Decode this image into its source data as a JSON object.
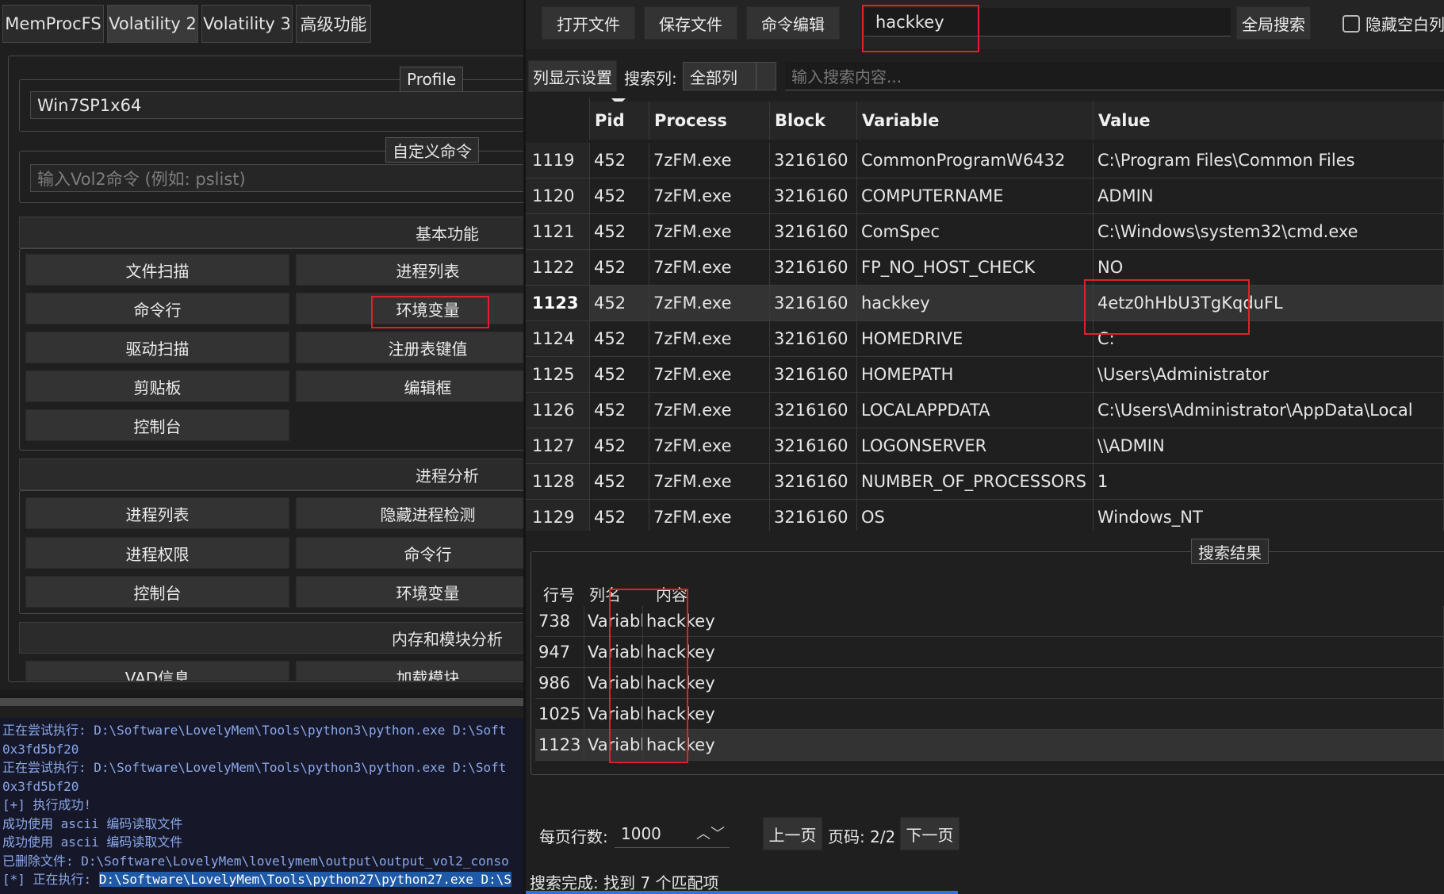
{
  "left": {
    "tabs": [
      "MemProcFS",
      "Volatility 2",
      "Volatility 3",
      "高级功能"
    ],
    "profile": {
      "legend": "Profile",
      "value": "Win7SP1x64"
    },
    "custom": {
      "legend": "自定义命令",
      "placeholder": "输入Vol2命令 (例如: pslist)"
    },
    "basic": {
      "title": "基本功能",
      "buttons": [
        "文件扫描",
        "进程列表",
        "命令行",
        "环境变量",
        "驱动扫描",
        "注册表键值",
        "剪贴板",
        "编辑框",
        "控制台"
      ]
    },
    "process": {
      "title": "进程分析",
      "buttons": [
        "进程列表",
        "隐藏进程检测",
        "进程权限",
        "命令行",
        "控制台",
        "环境变量"
      ]
    },
    "memory": {
      "title": "内存和模块分析",
      "buttons": [
        "VAD信息",
        "加载模块"
      ]
    }
  },
  "log": [
    "正在尝试执行: D:\\Software\\LovelyMem\\Tools\\python3\\python.exe D:\\Soft",
    "0x3fd5bf20",
    "正在尝试执行: D:\\Software\\LovelyMem\\Tools\\python3\\python.exe D:\\Soft",
    "0x3fd5bf20",
    "[+] 执行成功!",
    "成功使用 ascii 编码读取文件",
    "成功使用 ascii 编码读取文件",
    "已删除文件: D:\\Software\\LovelyMem\\lovelymem\\output\\output_vol2_conso"
  ],
  "log_last": {
    "prefix": "[*] 正在执行:",
    "highlight": "D:\\Software\\LovelyMem\\Tools\\python27\\python27.exe D:\\S"
  },
  "right": {
    "toolbar": {
      "open": "打开文件",
      "save": "保存文件",
      "edit": "命令编辑",
      "search_value": "hackkey",
      "global_search": "全局搜索",
      "hide_empty": "隐藏空白列"
    },
    "filter": {
      "col_settings": "列显示设置",
      "search_col_label": "搜索列:",
      "search_col_value": "全部列",
      "placeholder": "输入搜索内容..."
    },
    "columns": [
      "Pid",
      "Process",
      "Block",
      "Variable",
      "Value"
    ],
    "rows": [
      {
        "n": "1119",
        "c": [
          "452",
          "7zFM.exe",
          "3216160",
          "CommonProgramW6432",
          "C:\\Program Files\\Common Files"
        ]
      },
      {
        "n": "1120",
        "c": [
          "452",
          "7zFM.exe",
          "3216160",
          "COMPUTERNAME",
          "ADMIN"
        ]
      },
      {
        "n": "1121",
        "c": [
          "452",
          "7zFM.exe",
          "3216160",
          "ComSpec",
          "C:\\Windows\\system32\\cmd.exe"
        ]
      },
      {
        "n": "1122",
        "c": [
          "452",
          "7zFM.exe",
          "3216160",
          "FP_NO_HOST_CHECK",
          "NO"
        ]
      },
      {
        "n": "1123",
        "c": [
          "452",
          "7zFM.exe",
          "3216160",
          "hackkey",
          "4etz0hHbU3TgKqduFL"
        ]
      },
      {
        "n": "1124",
        "c": [
          "452",
          "7zFM.exe",
          "3216160",
          "HOMEDRIVE",
          "C:"
        ]
      },
      {
        "n": "1125",
        "c": [
          "452",
          "7zFM.exe",
          "3216160",
          "HOMEPATH",
          "\\Users\\Administrator"
        ]
      },
      {
        "n": "1126",
        "c": [
          "452",
          "7zFM.exe",
          "3216160",
          "LOCALAPPDATA",
          "C:\\Users\\Administrator\\AppData\\Local"
        ]
      },
      {
        "n": "1127",
        "c": [
          "452",
          "7zFM.exe",
          "3216160",
          "LOGONSERVER",
          "\\\\ADMIN"
        ]
      },
      {
        "n": "1128",
        "c": [
          "452",
          "7zFM.exe",
          "3216160",
          "NUMBER_OF_PROCESSORS",
          "1"
        ]
      },
      {
        "n": "1129",
        "c": [
          "452",
          "7zFM.exe",
          "3216160",
          "OS",
          "Windows_NT"
        ]
      }
    ],
    "results": {
      "legend": "搜索结果",
      "headers": [
        "行号",
        "列名",
        "内容"
      ],
      "rows": [
        [
          "738",
          "Variable",
          "hackkey"
        ],
        [
          "947",
          "Variable",
          "hackkey"
        ],
        [
          "986",
          "Variable",
          "hackkey"
        ],
        [
          "1025",
          "Variable",
          "hackkey"
        ],
        [
          "1123",
          "Variable",
          "hackkey"
        ]
      ]
    },
    "pager": {
      "rows_label": "每页行数:",
      "rows_value": "1000",
      "prev": "上一页",
      "page_label": "页码: 2/2",
      "next": "下一页"
    },
    "status": "搜索完成: 找到 7 个匹配项"
  }
}
